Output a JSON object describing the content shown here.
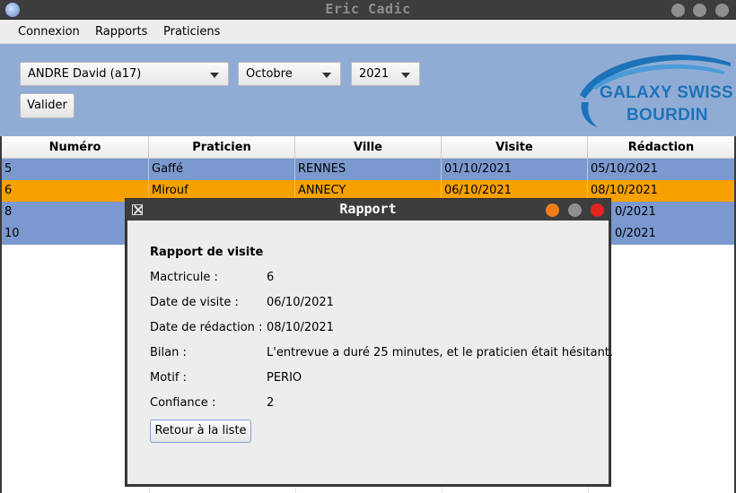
{
  "window": {
    "title": "Eric Cadic"
  },
  "menu": {
    "items": [
      "Connexion",
      "Rapports",
      "Praticiens"
    ]
  },
  "filters": {
    "praticien": "ANDRE David (a17)",
    "mois": "Octobre",
    "annee": "2021",
    "valider_label": "Valider"
  },
  "logo": {
    "line1": "GALAXY SWISS",
    "line2": "BOURDIN"
  },
  "table": {
    "columns": [
      "Numéro",
      "Praticien",
      "Ville",
      "Visite",
      "Rédaction"
    ],
    "rows": [
      [
        "5",
        "Gaffé",
        "RENNES",
        "01/10/2021",
        "05/10/2021"
      ],
      [
        "6",
        "Mirouf",
        "ANNECY",
        "06/10/2021",
        "08/10/2021"
      ],
      [
        "8",
        "",
        "",
        "",
        "0/2021"
      ],
      [
        "10",
        "",
        "",
        "",
        "0/2021"
      ]
    ],
    "selected_index": 1
  },
  "dialog": {
    "title": "Rapport",
    "heading": "Rapport de visite",
    "fields": [
      {
        "label": "Mactricule :",
        "value": "6"
      },
      {
        "label": "Date de visite :",
        "value": "06/10/2021"
      },
      {
        "label": "Date de rédaction :",
        "value": "08/10/2021"
      },
      {
        "label": "Bilan :",
        "value": "L'entrevue a duré 25 minutes, et le praticien était hésitant."
      },
      {
        "label": "Motif :",
        "value": "PERIO"
      },
      {
        "label": "Confiance :",
        "value": "2"
      }
    ],
    "back_label": "Retour à la liste"
  },
  "colors": {
    "row_blue": "#7b99cf",
    "row_selected": "#f6a100",
    "topbar": "#91acd4",
    "logo_blue": "#1d73b9",
    "dlg_orange": "#f07f1a",
    "dlg_red": "#e0241f"
  }
}
